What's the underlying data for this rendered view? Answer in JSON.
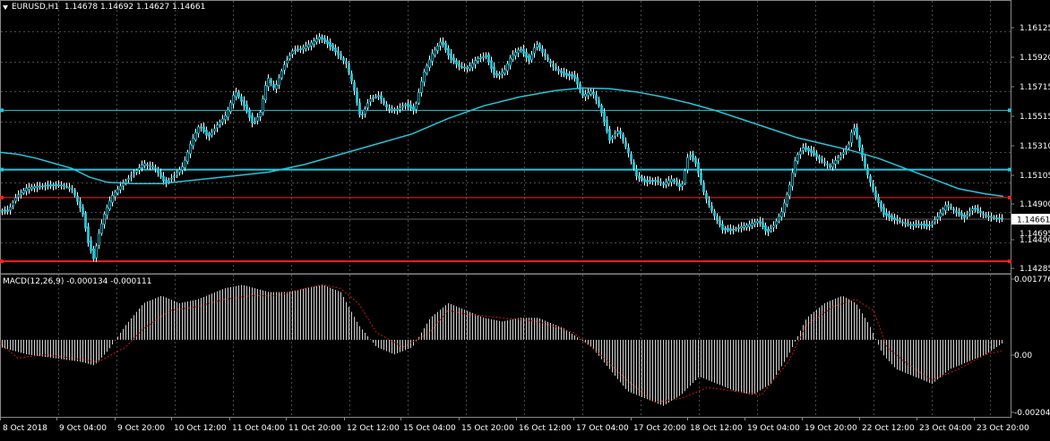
{
  "window": {
    "symbol": "EURUSD,H1",
    "ohlc": "1.14678 1.14692 1.14627 1.14661",
    "macd_label": "MACD(12,26,9) -0.000134 -0.000111"
  },
  "colors": {
    "background": "#000000",
    "grid": "#4a4a4a",
    "candle": "#ffffff",
    "ma_line": "#26c6da",
    "level_line": "#26c6da",
    "support_line": "#ff2020",
    "signal_line": "#d01818",
    "current_price_bg": "#ffffff"
  },
  "price_axis": {
    "ticks": [
      "1.16125",
      "1.15920",
      "1.15715",
      "1.15515",
      "1.15310",
      "1.15105",
      "1.14900",
      "1.14490",
      "1.14285"
    ],
    "current_price": "1.14661",
    "partial_label": "1.14695"
  },
  "macd_axis": {
    "ticks": [
      "0.001776",
      "0.00",
      "-0.00204"
    ]
  },
  "time_axis": {
    "labels": [
      "8 Oct 2018",
      "9 Oct 04:00",
      "9 Oct 20:00",
      "10 Oct 12:00",
      "11 Oct 04:00",
      "11 Oct 20:00",
      "12 Oct 12:00",
      "15 Oct 04:00",
      "15 Oct 20:00",
      "16 Oct 12:00",
      "17 Oct 04:00",
      "17 Oct 20:00",
      "18 Oct 12:00",
      "19 Oct 04:00",
      "19 Oct 20:00",
      "22 Oct 12:00",
      "23 Oct 04:00",
      "23 Oct 20:00"
    ]
  },
  "chart_data": {
    "type": "candlestick",
    "symbol": "EURUSD,H1",
    "price_range": [
      1.1424,
      1.1624
    ],
    "macd_range": [
      -0.0021,
      0.0018
    ],
    "horizontal_lines": [
      {
        "price": 1.15515,
        "color": "#26c6da"
      },
      {
        "price": 1.1505,
        "color": "#26c6da"
      },
      {
        "price": 1.1483,
        "color": "#ff2020"
      },
      {
        "price": 1.1433,
        "color": "#ff2020"
      }
    ],
    "close_path": [
      [
        0,
        1.1473
      ],
      [
        8,
        1.1472
      ],
      [
        18,
        1.1484
      ],
      [
        30,
        1.1491
      ],
      [
        42,
        1.1492
      ],
      [
        56,
        1.1492
      ],
      [
        70,
        1.1493
      ],
      [
        80,
        1.149
      ],
      [
        86,
        1.148
      ],
      [
        92,
        1.147
      ],
      [
        98,
        1.1448
      ],
      [
        104,
        1.1435
      ],
      [
        110,
        1.1455
      ],
      [
        116,
        1.147
      ],
      [
        124,
        1.1484
      ],
      [
        134,
        1.1492
      ],
      [
        146,
        1.15
      ],
      [
        160,
        1.151
      ],
      [
        172,
        1.1507
      ],
      [
        184,
        1.1494
      ],
      [
        194,
        1.15
      ],
      [
        204,
        1.1508
      ],
      [
        212,
        1.1525
      ],
      [
        222,
        1.154
      ],
      [
        232,
        1.153
      ],
      [
        242,
        1.154
      ],
      [
        252,
        1.1548
      ],
      [
        262,
        1.1567
      ],
      [
        272,
        1.1555
      ],
      [
        282,
        1.154
      ],
      [
        290,
        1.155
      ],
      [
        298,
        1.1578
      ],
      [
        306,
        1.1568
      ],
      [
        316,
        1.1586
      ],
      [
        326,
        1.1598
      ],
      [
        336,
        1.16
      ],
      [
        346,
        1.1604
      ],
      [
        356,
        1.1609
      ],
      [
        366,
        1.1603
      ],
      [
        376,
        1.1596
      ],
      [
        386,
        1.1588
      ],
      [
        394,
        1.157
      ],
      [
        402,
        1.1545
      ],
      [
        412,
        1.156
      ],
      [
        422,
        1.1563
      ],
      [
        432,
        1.1553
      ],
      [
        442,
        1.1552
      ],
      [
        452,
        1.1556
      ],
      [
        462,
        1.1551
      ],
      [
        472,
        1.158
      ],
      [
        482,
        1.1596
      ],
      [
        492,
        1.1606
      ],
      [
        502,
        1.1592
      ],
      [
        512,
        1.1586
      ],
      [
        522,
        1.1585
      ],
      [
        532,
        1.1592
      ],
      [
        542,
        1.1594
      ],
      [
        552,
        1.1578
      ],
      [
        562,
        1.1582
      ],
      [
        570,
        1.1594
      ],
      [
        580,
        1.16
      ],
      [
        590,
        1.159
      ],
      [
        598,
        1.1604
      ],
      [
        608,
        1.1594
      ],
      [
        618,
        1.1585
      ],
      [
        630,
        1.1579
      ],
      [
        640,
        1.1578
      ],
      [
        650,
        1.1563
      ],
      [
        660,
        1.1567
      ],
      [
        670,
        1.1552
      ],
      [
        680,
        1.1528
      ],
      [
        690,
        1.1536
      ],
      [
        700,
        1.152
      ],
      [
        710,
        1.15
      ],
      [
        720,
        1.1495
      ],
      [
        730,
        1.1496
      ],
      [
        740,
        1.1494
      ],
      [
        750,
        1.1498
      ],
      [
        760,
        1.149
      ],
      [
        768,
        1.1518
      ],
      [
        776,
        1.151
      ],
      [
        786,
        1.1485
      ],
      [
        796,
        1.147
      ],
      [
        806,
        1.1458
      ],
      [
        816,
        1.1457
      ],
      [
        826,
        1.146
      ],
      [
        836,
        1.1462
      ],
      [
        846,
        1.1465
      ],
      [
        856,
        1.1455
      ],
      [
        864,
        1.1462
      ],
      [
        872,
        1.1472
      ],
      [
        880,
        1.149
      ],
      [
        888,
        1.1515
      ],
      [
        896,
        1.1522
      ],
      [
        906,
        1.1518
      ],
      [
        916,
        1.1512
      ],
      [
        926,
        1.1508
      ],
      [
        936,
        1.1515
      ],
      [
        946,
        1.1522
      ],
      [
        952,
        1.154
      ],
      [
        958,
        1.1525
      ],
      [
        966,
        1.1505
      ],
      [
        976,
        1.1485
      ],
      [
        986,
        1.147
      ],
      [
        996,
        1.1466
      ],
      [
        1006,
        1.1464
      ],
      [
        1016,
        1.1462
      ],
      [
        1026,
        1.1462
      ],
      [
        1036,
        1.146
      ],
      [
        1046,
        1.1468
      ],
      [
        1056,
        1.1478
      ],
      [
        1066,
        1.1472
      ],
      [
        1076,
        1.1467
      ],
      [
        1086,
        1.1475
      ],
      [
        1096,
        1.147
      ],
      [
        1106,
        1.1468
      ],
      [
        1118,
        1.1466
      ]
    ],
    "ma_path": [
      [
        0,
        1.15185
      ],
      [
        20,
        1.1517
      ],
      [
        40,
        1.1514
      ],
      [
        60,
        1.151
      ],
      [
        80,
        1.1506
      ],
      [
        100,
        1.1499
      ],
      [
        120,
        1.1495
      ],
      [
        150,
        1.1494
      ],
      [
        180,
        1.1494
      ],
      [
        220,
        1.1497
      ],
      [
        260,
        1.15
      ],
      [
        300,
        1.1503
      ],
      [
        340,
        1.1509
      ],
      [
        380,
        1.1517
      ],
      [
        420,
        1.1525
      ],
      [
        460,
        1.1533
      ],
      [
        500,
        1.1545
      ],
      [
        540,
        1.1555
      ],
      [
        580,
        1.1562
      ],
      [
        620,
        1.1567
      ],
      [
        650,
        1.1569
      ],
      [
        680,
        1.15685
      ],
      [
        710,
        1.1566
      ],
      [
        740,
        1.1562
      ],
      [
        770,
        1.1557
      ],
      [
        800,
        1.1551
      ],
      [
        830,
        1.1544
      ],
      [
        860,
        1.1537
      ],
      [
        890,
        1.153
      ],
      [
        920,
        1.1525
      ],
      [
        950,
        1.152
      ],
      [
        980,
        1.1514
      ],
      [
        1010,
        1.1506
      ],
      [
        1040,
        1.1498
      ],
      [
        1070,
        1.149
      ],
      [
        1100,
        1.1486
      ],
      [
        1120,
        1.1484
      ]
    ],
    "macd_hist_path": [
      [
        0,
        -0.0002
      ],
      [
        30,
        -0.0004
      ],
      [
        60,
        -0.0005
      ],
      [
        90,
        -0.0006
      ],
      [
        105,
        -0.0007
      ],
      [
        120,
        -0.0003
      ],
      [
        140,
        0.0004
      ],
      [
        160,
        0.001
      ],
      [
        180,
        0.0012
      ],
      [
        200,
        0.001
      ],
      [
        220,
        0.0011
      ],
      [
        250,
        0.0014
      ],
      [
        270,
        0.0015
      ],
      [
        300,
        0.0013
      ],
      [
        320,
        0.0013
      ],
      [
        340,
        0.0014
      ],
      [
        360,
        0.0015
      ],
      [
        380,
        0.0013
      ],
      [
        400,
        0.0004
      ],
      [
        420,
        -0.0002
      ],
      [
        440,
        -0.0004
      ],
      [
        460,
        -0.0002
      ],
      [
        480,
        0.0006
      ],
      [
        500,
        0.001
      ],
      [
        520,
        0.0008
      ],
      [
        540,
        0.0006
      ],
      [
        560,
        0.0005
      ],
      [
        580,
        0.0006
      ],
      [
        600,
        0.0006
      ],
      [
        630,
        0.0003
      ],
      [
        660,
        -0.0002
      ],
      [
        680,
        -0.0008
      ],
      [
        700,
        -0.0014
      ],
      [
        720,
        -0.0016
      ],
      [
        740,
        -0.0018
      ],
      [
        760,
        -0.0015
      ],
      [
        780,
        -0.001
      ],
      [
        800,
        -0.0012
      ],
      [
        820,
        -0.0014
      ],
      [
        840,
        -0.0015
      ],
      [
        860,
        -0.0012
      ],
      [
        880,
        -0.0004
      ],
      [
        900,
        0.0006
      ],
      [
        920,
        0.001
      ],
      [
        940,
        0.0012
      ],
      [
        955,
        0.001
      ],
      [
        970,
        0.0004
      ],
      [
        985,
        -0.0004
      ],
      [
        1000,
        -0.0008
      ],
      [
        1020,
        -0.001
      ],
      [
        1040,
        -0.0012
      ],
      [
        1060,
        -0.0008
      ],
      [
        1080,
        -0.0006
      ],
      [
        1100,
        -0.0004
      ],
      [
        1118,
        -0.0001
      ]
    ],
    "macd_signal_path": [
      [
        0,
        -0.0001
      ],
      [
        20,
        -0.0005
      ],
      [
        50,
        -0.0004
      ],
      [
        80,
        -0.0005
      ],
      [
        110,
        -0.0006
      ],
      [
        140,
        -0.0002
      ],
      [
        160,
        0.0003
      ],
      [
        190,
        0.0008
      ],
      [
        220,
        0.0009
      ],
      [
        250,
        0.0011
      ],
      [
        280,
        0.0012
      ],
      [
        310,
        0.0012
      ],
      [
        340,
        0.0014
      ],
      [
        360,
        0.0015
      ],
      [
        380,
        0.0014
      ],
      [
        400,
        0.001
      ],
      [
        420,
        0.0002
      ],
      [
        450,
        -0.0002
      ],
      [
        480,
        0.0002
      ],
      [
        500,
        0.0008
      ],
      [
        520,
        0.0007
      ],
      [
        560,
        0.0006
      ],
      [
        600,
        0.0005
      ],
      [
        640,
        0.0002
      ],
      [
        670,
        -0.0004
      ],
      [
        700,
        -0.0011
      ],
      [
        730,
        -0.0017
      ],
      [
        760,
        -0.0016
      ],
      [
        790,
        -0.0013
      ],
      [
        820,
        -0.0014
      ],
      [
        850,
        -0.0015
      ],
      [
        880,
        -0.0006
      ],
      [
        900,
        0.0004
      ],
      [
        930,
        0.0009
      ],
      [
        955,
        0.0011
      ],
      [
        975,
        0.0008
      ],
      [
        990,
        -0.0002
      ],
      [
        1010,
        -0.0006
      ],
      [
        1040,
        -0.0011
      ],
      [
        1070,
        -0.0008
      ],
      [
        1100,
        -0.0004
      ],
      [
        1118,
        -0.0003
      ]
    ]
  }
}
